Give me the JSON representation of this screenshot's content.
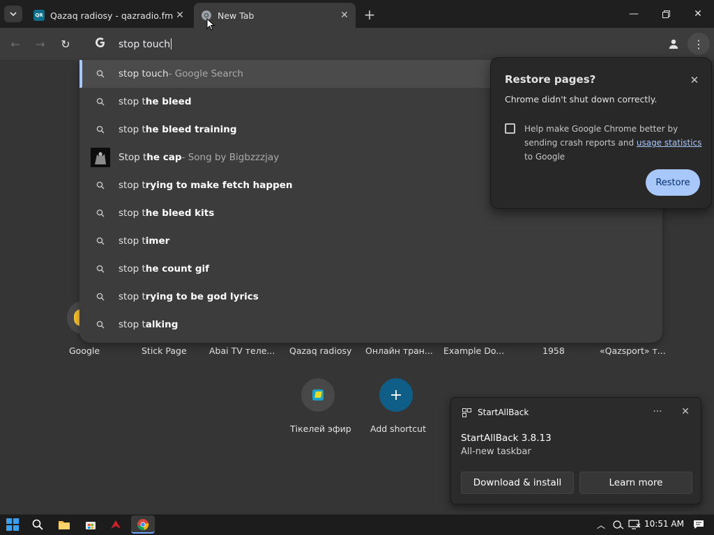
{
  "tabs": [
    {
      "title": "Qazaq radiosy - qazradio.fm | K",
      "active": false,
      "favicon_label": "QR"
    },
    {
      "title": "New Tab",
      "active": true
    }
  ],
  "omnibox": {
    "text": "stop touch"
  },
  "suggestions": [
    {
      "base": "stop touch",
      "bold": "",
      "suffix": " - Google Search",
      "icon": "search-icon",
      "selected": true
    },
    {
      "base": "stop t",
      "bold": "he bleed",
      "suffix": "",
      "icon": "search-icon",
      "selected": false
    },
    {
      "base": "stop t",
      "bold": "he bleed training",
      "suffix": "",
      "icon": "search-icon",
      "selected": false
    },
    {
      "base": "Stop t",
      "bold": "he cap",
      "suffix": " - Song by Bigbzzzjay",
      "icon": "thumbnail",
      "selected": false
    },
    {
      "base": "stop t",
      "bold": "rying to make fetch happen",
      "suffix": "",
      "icon": "search-icon",
      "selected": false
    },
    {
      "base": "stop t",
      "bold": "he bleed kits",
      "suffix": "",
      "icon": "search-icon",
      "selected": false
    },
    {
      "base": "stop t",
      "bold": "imer",
      "suffix": "",
      "icon": "search-icon",
      "selected": false
    },
    {
      "base": "stop t",
      "bold": "he count gif",
      "suffix": "",
      "icon": "search-icon",
      "selected": false
    },
    {
      "base": "stop t",
      "bold": "rying to be god lyrics",
      "suffix": "",
      "icon": "search-icon",
      "selected": false
    },
    {
      "base": "stop t",
      "bold": "alking",
      "suffix": "",
      "icon": "search-icon",
      "selected": false
    }
  ],
  "shortcuts_row1": [
    "Google",
    "Stick Page",
    "Abai TV теле...",
    "Qazaq radiosy",
    "Онлайн тран...",
    "Example Do...",
    "1958",
    "«Qazsport» т..."
  ],
  "shortcuts_row2": [
    "Тікелей эфир",
    "Add shortcut"
  ],
  "restore_popup": {
    "title": "Restore pages?",
    "message": "Chrome didn't shut down correctly.",
    "checkbox_text_before": "Help make Google Chrome better by sending crash reports and ",
    "checkbox_link": "usage statistics",
    "checkbox_text_after": " to Google",
    "button": "Restore"
  },
  "notification": {
    "app": "StartAllBack",
    "title": "StartAllBack 3.8.13",
    "subtitle": "All-new taskbar",
    "button_primary": "Download & install",
    "button_secondary": "Learn more"
  },
  "taskbar": {
    "clock": "10:51 AM"
  },
  "colors": {
    "accent": "#a8c7fa",
    "tab_active": "#3c3c3c",
    "page_bg": "#353535"
  }
}
